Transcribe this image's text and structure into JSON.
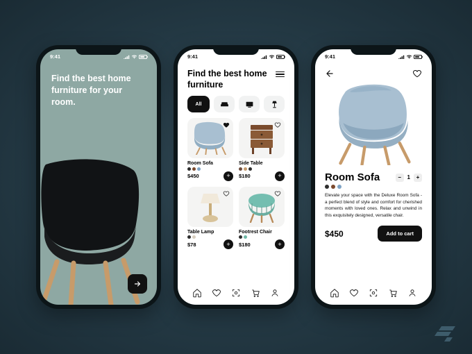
{
  "status": {
    "time": "9:41"
  },
  "screen1": {
    "headline": "Find the best home furniture for your room."
  },
  "screen2": {
    "title": "Find the best home furniture",
    "chips": [
      "All",
      "sofa-icon",
      "tv-icon",
      "lamp-icon"
    ],
    "products": [
      {
        "name": "Room Sofa",
        "price": "$450",
        "colors": [
          "#2d2d2d",
          "#7c4a2d",
          "#7fa3c4"
        ],
        "fav": true
      },
      {
        "name": "Side Table",
        "price": "$180",
        "colors": [
          "#6d4c3d",
          "#c49a6c",
          "#2d2d2d"
        ],
        "fav": false
      },
      {
        "name": "Table Lamp",
        "price": "$78",
        "colors": [
          "#2d2d2d",
          "#d8cfc0"
        ],
        "fav": false
      },
      {
        "name": "Footrest Chair",
        "price": "$180",
        "colors": [
          "#2d2d2d",
          "#6fb7a6"
        ],
        "fav": false
      }
    ]
  },
  "screen3": {
    "product_name": "Room Sofa",
    "qty": "1",
    "colors": [
      "#2d2d2d",
      "#7c4a2d",
      "#7fa3c4"
    ],
    "description": "Elevate your space with the Deluxe Room Sofa - a perfect blend of style and comfort for cherished moments with loved ones. Relax and unwind in this exquisitely designed, versatile chair.",
    "price": "$450",
    "cta": "Add to cart"
  }
}
